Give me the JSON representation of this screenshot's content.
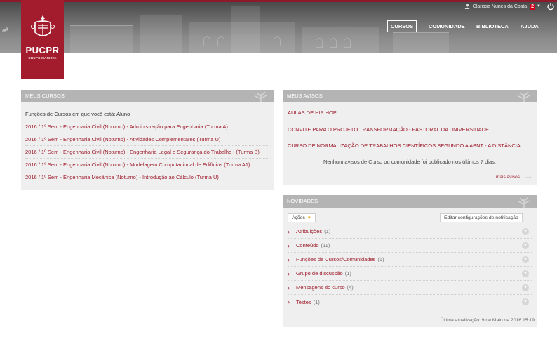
{
  "header": {
    "logo_name": "PUCPR",
    "logo_sub": "GRUPO MARISTA",
    "user_name": "Clarissa Nunes da Costa",
    "notifications_count": "2",
    "nav": [
      "CURSOS",
      "COMUNIDADE",
      "BIBLIOTECA",
      "AJUDA"
    ]
  },
  "cursos": {
    "title": "MEUS CURSOS",
    "role_text": "Funções de Cursos em que você está: Aluno",
    "items": [
      "2016 / 1º Sem - Engenharia Civil (Noturno) - Administração para Engenharia (Turma A)",
      "2016 / 1º Sem - Engenharia Civil (Noturno) - Atividades Complementares (Turma U)",
      "2016 / 1º Sem - Engenharia Civil (Noturno) - Engenharia Legal e Segurança do Trabalho I (Turma B)",
      "2016 / 1º Sem - Engenharia Civil (Noturno) - Modelagem Computacional de Edifícios (Turma A1)",
      "2016 / 1º Sem - Engenharia Mecânica (Noturno) - Introdução ao Cálculo (Turma U)"
    ]
  },
  "avisos": {
    "title": "MEUS AVISOS",
    "items": [
      "AULAS DE HIP HOP",
      "CONVITE PARA O PROJETO TRANSFORMAÇÃO - PASTORAL DA UNIVERSIDADE",
      "CURSO DE NORMALIZAÇÃO DE TRABALHOS CIENTÍFICOS SEGUNDO A ABNT - A DISTÂNCIA"
    ],
    "empty_text": "Nenhum avisos de Curso ou comunidade foi publicado nos últimos 7 dias.",
    "more_link": "mais avisos..."
  },
  "novidades": {
    "title": "NOVIDADES",
    "actions_label": "Ações",
    "edit_button": "Editar configurações de notificação",
    "rows": [
      {
        "label": "Atribuições",
        "count": "(1)"
      },
      {
        "label": "Conteúdo",
        "count": "(11)"
      },
      {
        "label": "Funções de Cursos/Comunidades",
        "count": "(6)"
      },
      {
        "label": "Grupo de discussão",
        "count": "(1)"
      },
      {
        "label": "Mensagens do curso",
        "count": "(4)"
      },
      {
        "label": "Testes",
        "count": "(1)"
      }
    ],
    "updated": "Última atualização: 9 de Maio de 2016 15:19"
  },
  "colors": {
    "brand": "#a31c2e",
    "link": "#9d1c2c",
    "panel_header": "#b4b4b4",
    "panel_bg": "#efefef"
  }
}
